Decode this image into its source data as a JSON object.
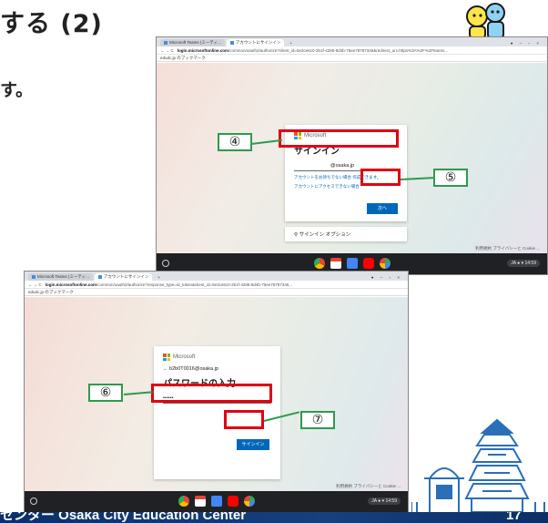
{
  "page": {
    "heading": "する (2)",
    "subtext": "す。",
    "footer_left": "センター Osaka City Education Center",
    "page_number": "17"
  },
  "screenshot1": {
    "tabs": [
      "Microsoft Teams (ミーティ...",
      "アカウントにサインイン"
    ],
    "new_tab": "+",
    "window_controls": "● – ▫ ×",
    "nav": "← → C",
    "url_host": "login.microsoftonline.com",
    "url_rest": "/common/oauth2/authorize?client_id=5e3ce6c0-2b1f-4285-8d4b-75ee78787346&redirect_uri=https%3A%2F%2Fteams...",
    "bookmark": "edudc.jp のブックマーク",
    "brand": "Microsoft",
    "title": "サインイン",
    "email_value": "@osaka.jp",
    "link1": "アカウントをお持ちでない場合 作成できます。",
    "link2": "アカウントにアクセスできない場合",
    "next_button": "次へ",
    "signin_options": "サインイン オプション",
    "footer_links": "利用規約  プライバシーと Cookie  ...",
    "status": "JA ● ▾ 14:59"
  },
  "screenshot2": {
    "tabs": [
      "Microsoft Teams (ミーティ...",
      "アカウントにサインイン"
    ],
    "new_tab": "+",
    "window_controls": "● – ▫ ×",
    "nav": "← → C",
    "url_host": "login.microsoftonline.com",
    "url_rest": "/common/oauth2/authorize?response_type=id_token&client_id=5e3ce6c0-2b1f-4285-8d4b-75ee78787346...",
    "bookmark": "edudc.jp のブックマーク",
    "brand": "Microsoft",
    "back_email": "← b2b0T0016@osaka.jp",
    "title": "パスワードの入力",
    "password_value": "••••••",
    "signin_button": "サインイン",
    "footer_links": "利用規約  プライバシーと Cookie  ...",
    "status": "JA ● ▾ 14:59"
  },
  "callouts": {
    "c4": "④",
    "c5": "⑤",
    "c6": "⑥",
    "c7": "⑦"
  },
  "colors": {
    "highlight": "#e00012",
    "callout_border": "#2e9a4e",
    "footer_bg": "#16407f",
    "ms_blue": "#0067b8"
  },
  "icons": [
    "mascot-icon",
    "castle-icon",
    "chrome-icon",
    "gmail-icon",
    "docs-icon",
    "youtube-icon",
    "play-icon",
    "launcher-icon",
    "microsoft-logo-icon",
    "key-icon"
  ]
}
